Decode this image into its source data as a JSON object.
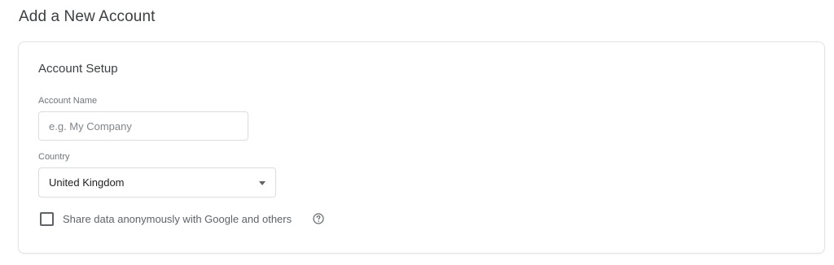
{
  "page": {
    "title": "Add a New Account"
  },
  "account_setup": {
    "section_title": "Account Setup",
    "account_name": {
      "label": "Account Name",
      "value": "",
      "placeholder": "e.g. My Company"
    },
    "country": {
      "label": "Country",
      "selected": "United Kingdom"
    },
    "share_data": {
      "label": "Share data anonymously with Google and others",
      "checked": false,
      "help_icon": "help-circle-icon"
    }
  }
}
